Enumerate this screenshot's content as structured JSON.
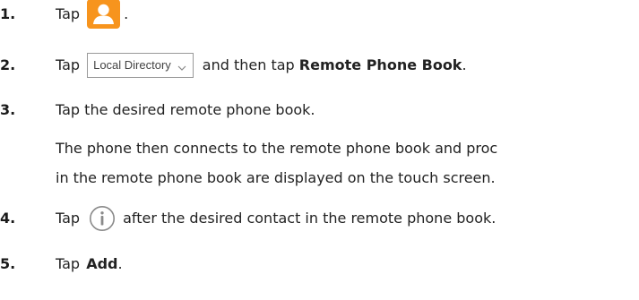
{
  "steps": [
    {
      "number": "1.",
      "before": "Tap",
      "after": "."
    },
    {
      "number": "2.",
      "before": "Tap",
      "dropdown_label": "Local Directory",
      "middle": "and then tap",
      "bold": "Remote Phone Book",
      "after": "."
    },
    {
      "number": "3.",
      "text": "Tap the desired remote phone book.",
      "note_line1": "The phone then connects to the remote phone book and proc",
      "note_line2": "in the remote phone book are displayed on the touch screen."
    },
    {
      "number": "4.",
      "before": "Tap",
      "after": "after the desired contact in the remote phone book."
    },
    {
      "number": "5.",
      "before": "Tap",
      "bold": "Add",
      "after": "."
    }
  ],
  "icons": {
    "contacts": "contacts-icon",
    "info": "info-icon",
    "dropdown_caret": "chevron-down-icon"
  },
  "colors": {
    "contacts_icon_bg": "#F7941D",
    "info_icon_stroke": "#8a8a8a"
  }
}
